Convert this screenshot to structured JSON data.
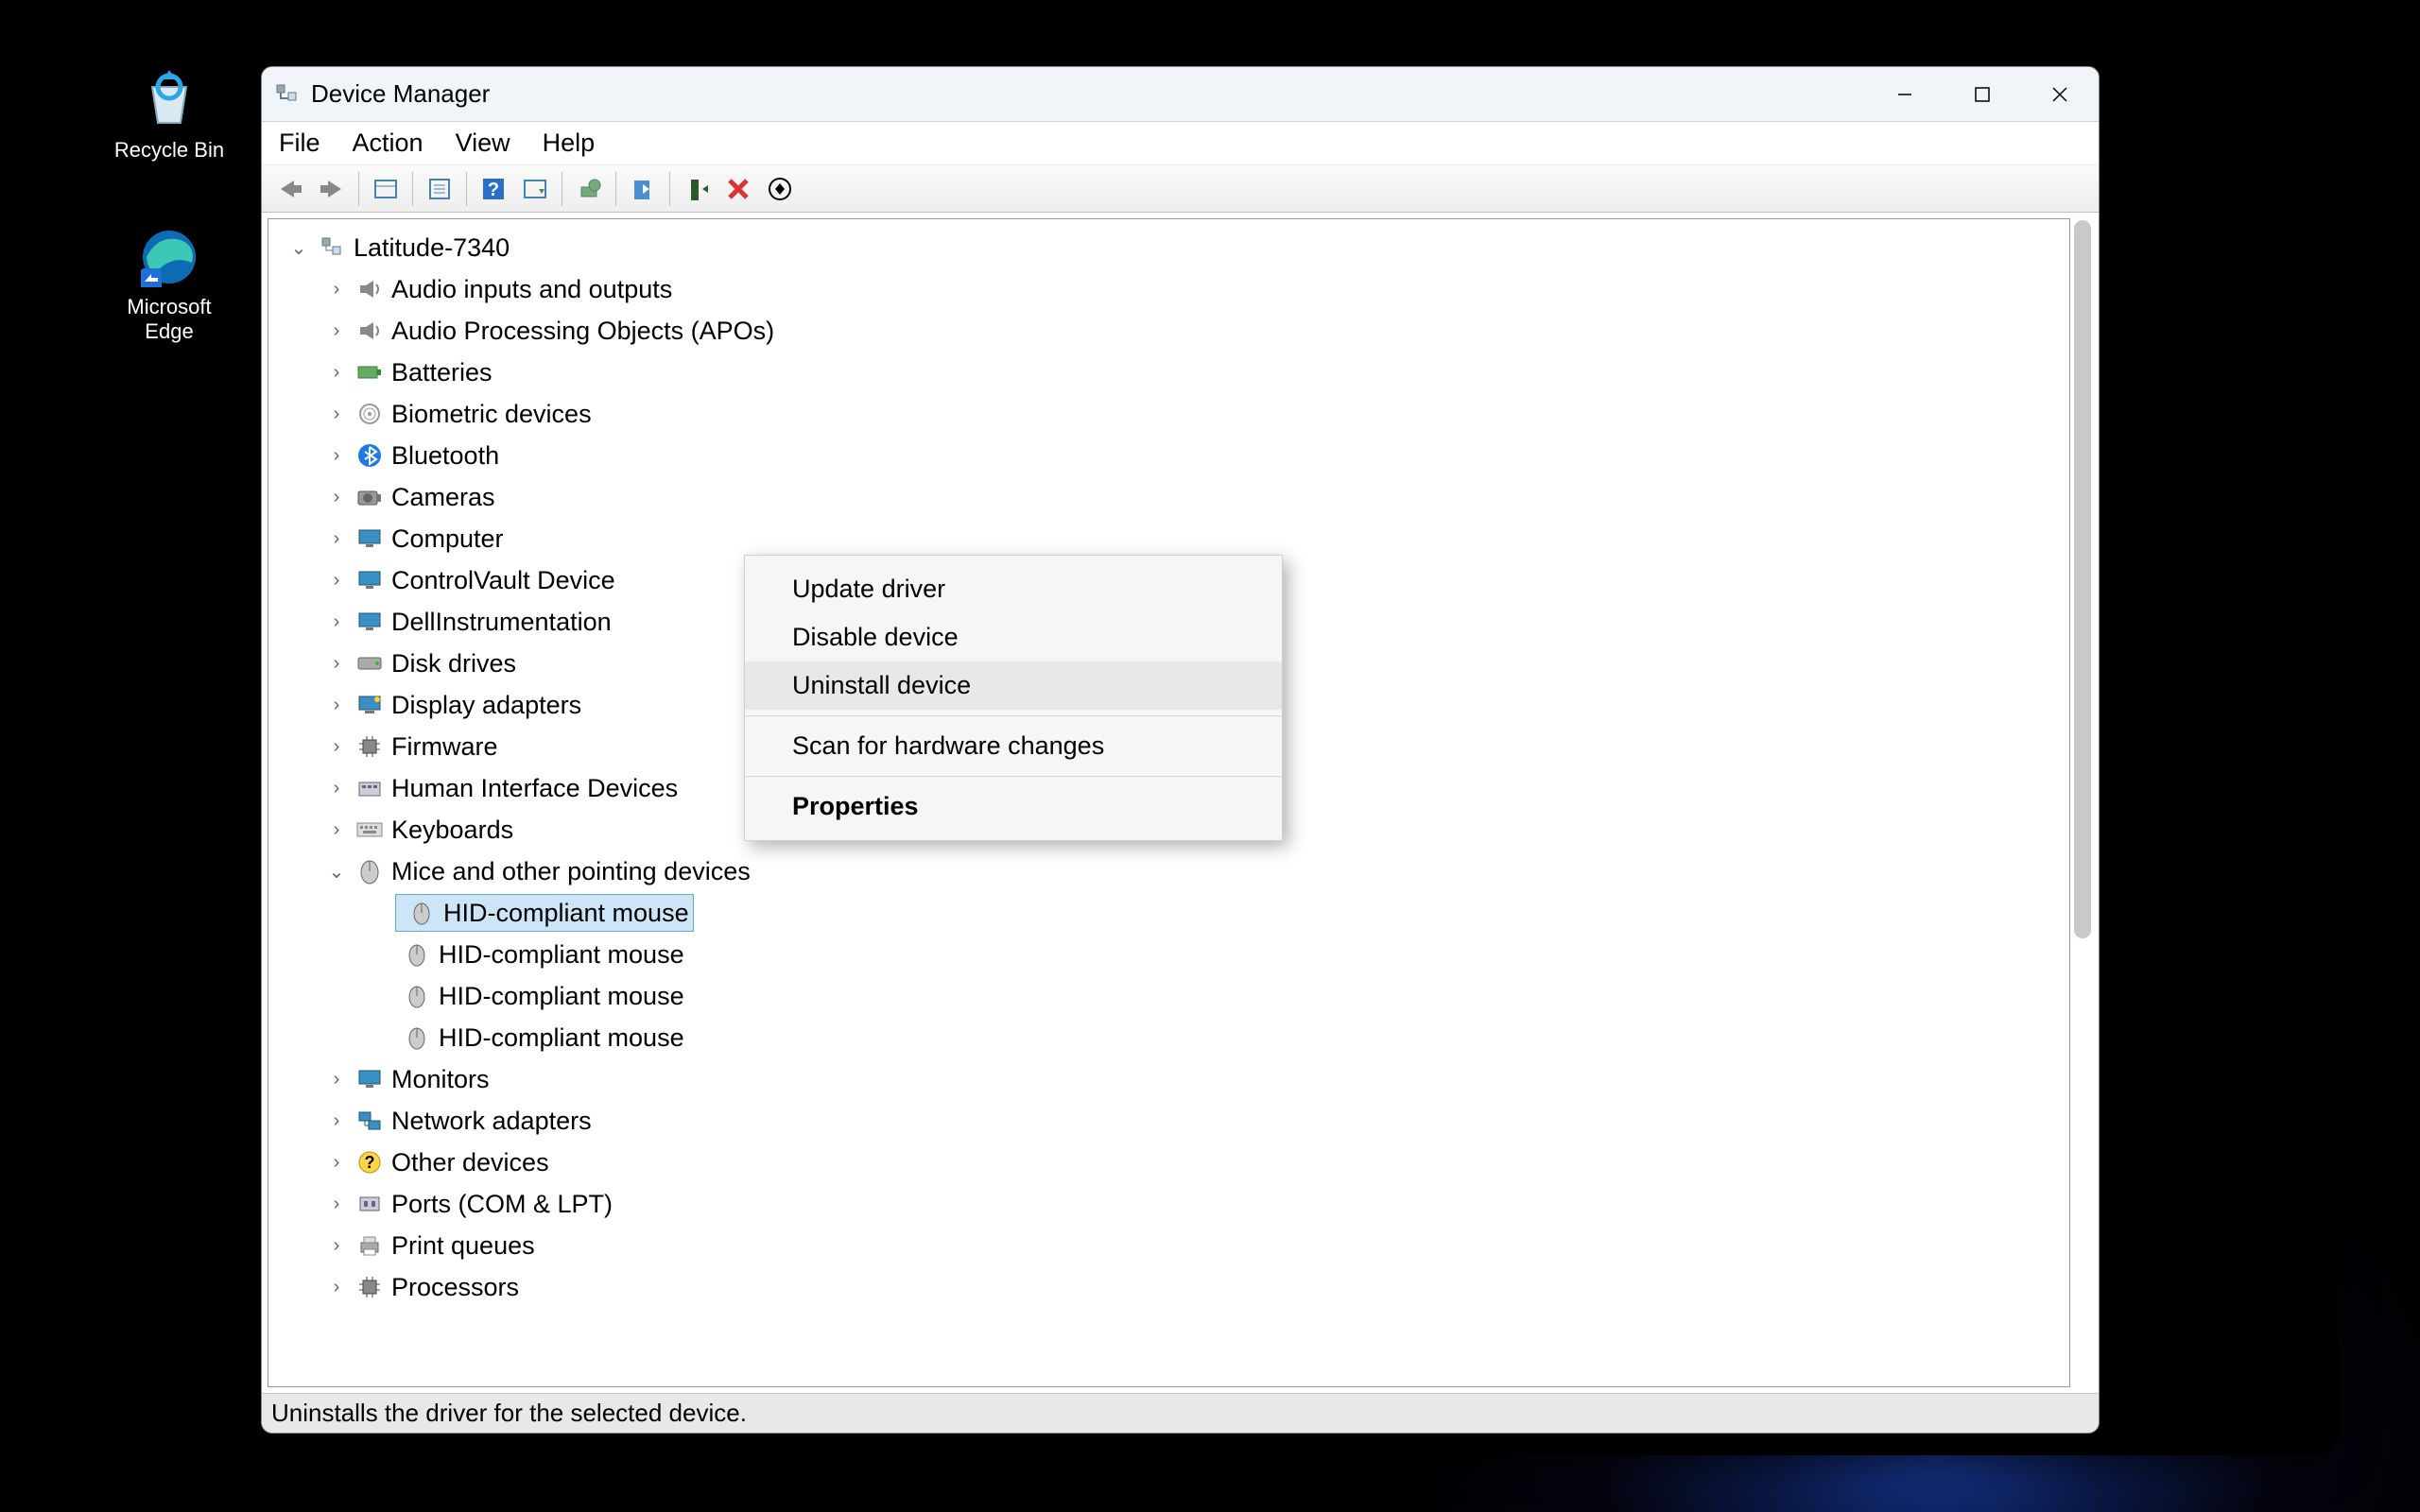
{
  "desktop": {
    "recycle_label": "Recycle Bin",
    "edge_label": "Microsoft Edge"
  },
  "window": {
    "title": "Device Manager",
    "menus": {
      "file": "File",
      "action": "Action",
      "view": "View",
      "help": "Help"
    },
    "status": "Uninstalls the driver for the selected device."
  },
  "tree": {
    "root": "Latitude-7340",
    "categories": [
      {
        "label": "Audio inputs and outputs",
        "icon": "speaker"
      },
      {
        "label": "Audio Processing Objects (APOs)",
        "icon": "speaker"
      },
      {
        "label": "Batteries",
        "icon": "battery"
      },
      {
        "label": "Biometric devices",
        "icon": "fingerprint"
      },
      {
        "label": "Bluetooth",
        "icon": "bluetooth"
      },
      {
        "label": "Cameras",
        "icon": "camera"
      },
      {
        "label": "Computer",
        "icon": "monitor"
      },
      {
        "label": "ControlVault Device",
        "icon": "monitor"
      },
      {
        "label": "DellInstrumentation",
        "icon": "monitor"
      },
      {
        "label": "Disk drives",
        "icon": "disk"
      },
      {
        "label": "Display adapters",
        "icon": "display"
      },
      {
        "label": "Firmware",
        "icon": "chip"
      },
      {
        "label": "Human Interface Devices",
        "icon": "hid"
      },
      {
        "label": "Keyboards",
        "icon": "keyboard"
      }
    ],
    "mice_label": "Mice and other pointing devices",
    "mice_children": [
      "HID-compliant mouse",
      "HID-compliant mouse",
      "HID-compliant mouse",
      "HID-compliant mouse"
    ],
    "after": [
      {
        "label": "Monitors",
        "icon": "monitor"
      },
      {
        "label": "Network adapters",
        "icon": "network"
      },
      {
        "label": "Other devices",
        "icon": "warning"
      },
      {
        "label": "Ports (COM & LPT)",
        "icon": "port"
      },
      {
        "label": "Print queues",
        "icon": "printer"
      },
      {
        "label": "Processors",
        "icon": "chip"
      }
    ]
  },
  "context_menu": {
    "update": "Update driver",
    "disable": "Disable device",
    "uninstall": "Uninstall device",
    "scan": "Scan for hardware changes",
    "properties": "Properties"
  }
}
